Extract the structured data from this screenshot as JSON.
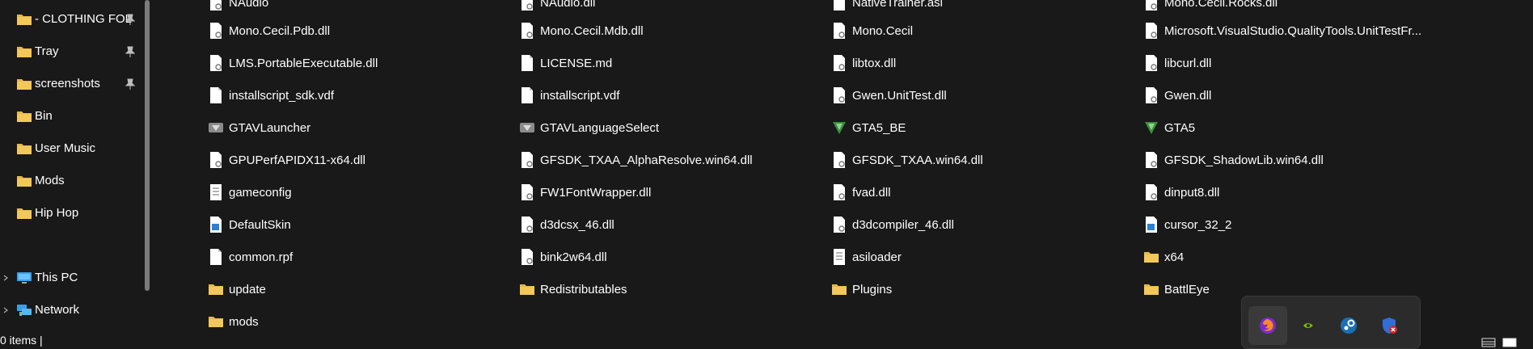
{
  "sidebar": {
    "items": [
      {
        "label": "- CLOTHING FOL",
        "icon": "folder-icon",
        "pinned": true
      },
      {
        "label": "Tray",
        "icon": "folder-icon",
        "pinned": true
      },
      {
        "label": "screenshots",
        "icon": "folder-icon",
        "pinned": true
      },
      {
        "label": "Bin",
        "icon": "folder-icon",
        "pinned": false
      },
      {
        "label": "User Music",
        "icon": "folder-icon",
        "pinned": false
      },
      {
        "label": "Mods",
        "icon": "folder-icon",
        "pinned": false
      },
      {
        "label": "Hip Hop",
        "icon": "folder-icon",
        "pinned": false
      },
      {
        "label": "This PC",
        "icon": "computer-icon",
        "pinned": false
      },
      {
        "label": "Network",
        "icon": "network-icon",
        "pinned": false
      }
    ]
  },
  "files": {
    "col1": [
      {
        "name": "NAudio",
        "icon": "dll-file-icon"
      },
      {
        "name": "Mono.Cecil.Pdb.dll",
        "icon": "dll-file-icon"
      },
      {
        "name": "LMS.PortableExecutable.dll",
        "icon": "dll-file-icon"
      },
      {
        "name": "installscript_sdk.vdf",
        "icon": "file-icon"
      },
      {
        "name": "GTAVLauncher",
        "icon": "rockstar-app-icon"
      },
      {
        "name": "GPUPerfAPIDX11-x64.dll",
        "icon": "dll-file-icon"
      },
      {
        "name": "gameconfig",
        "icon": "text-file-icon"
      },
      {
        "name": "DefaultSkin",
        "icon": "image-file-icon"
      },
      {
        "name": "common.rpf",
        "icon": "file-icon"
      },
      {
        "name": "update",
        "icon": "folder-icon"
      },
      {
        "name": "mods",
        "icon": "folder-icon"
      }
    ],
    "col2": [
      {
        "name": "NAudio.dll",
        "icon": "dll-file-icon"
      },
      {
        "name": "Mono.Cecil.Mdb.dll",
        "icon": "dll-file-icon"
      },
      {
        "name": "LICENSE.md",
        "icon": "file-icon"
      },
      {
        "name": "installscript.vdf",
        "icon": "file-icon"
      },
      {
        "name": "GTAVLanguageSelect",
        "icon": "rockstar-app-icon"
      },
      {
        "name": "GFSDK_TXAA_AlphaResolve.win64.dll",
        "icon": "dll-file-icon"
      },
      {
        "name": "FW1FontWrapper.dll",
        "icon": "dll-file-icon"
      },
      {
        "name": "d3dcsx_46.dll",
        "icon": "dll-file-icon"
      },
      {
        "name": "bink2w64.dll",
        "icon": "dll-file-icon"
      },
      {
        "name": "Redistributables",
        "icon": "folder-icon"
      }
    ],
    "col3": [
      {
        "name": "NativeTrainer.asi",
        "icon": "file-icon"
      },
      {
        "name": "Mono.Cecil",
        "icon": "dll-file-icon"
      },
      {
        "name": "libtox.dll",
        "icon": "dll-file-icon"
      },
      {
        "name": "Gwen.UnitTest.dll",
        "icon": "dll-file-icon"
      },
      {
        "name": "GTA5_BE",
        "icon": "gta-v-icon"
      },
      {
        "name": "GFSDK_TXAA.win64.dll",
        "icon": "dll-file-icon"
      },
      {
        "name": "fvad.dll",
        "icon": "dll-file-icon"
      },
      {
        "name": "d3dcompiler_46.dll",
        "icon": "dll-file-icon"
      },
      {
        "name": "asiloader",
        "icon": "text-file-icon"
      },
      {
        "name": "Plugins",
        "icon": "folder-icon"
      }
    ],
    "col4": [
      {
        "name": "Mono.Cecil.Rocks.dll",
        "icon": "dll-file-icon"
      },
      {
        "name": "Microsoft.VisualStudio.QualityTools.UnitTestFr...",
        "icon": "dll-file-icon"
      },
      {
        "name": "libcurl.dll",
        "icon": "dll-file-icon"
      },
      {
        "name": "Gwen.dll",
        "icon": "dll-file-icon"
      },
      {
        "name": "GTA5",
        "icon": "gta-v-icon"
      },
      {
        "name": "GFSDK_ShadowLib.win64.dll",
        "icon": "dll-file-icon"
      },
      {
        "name": "dinput8.dll",
        "icon": "dll-file-icon"
      },
      {
        "name": "cursor_32_2",
        "icon": "image-file-icon"
      },
      {
        "name": "x64",
        "icon": "folder-icon"
      },
      {
        "name": "BattlEye",
        "icon": "folder-icon"
      }
    ]
  },
  "status_bar": {
    "items_text": "0 items  |"
  },
  "tray": {
    "icons": [
      {
        "name": "firefox-icon"
      },
      {
        "name": "nvidia-icon"
      },
      {
        "name": "steam-icon"
      },
      {
        "name": "security-shield-icon"
      }
    ]
  },
  "colors": {
    "background": "#191919",
    "text": "#ffffff",
    "folder": "#e8b84a",
    "tray_bg": "#2b2b2b"
  }
}
